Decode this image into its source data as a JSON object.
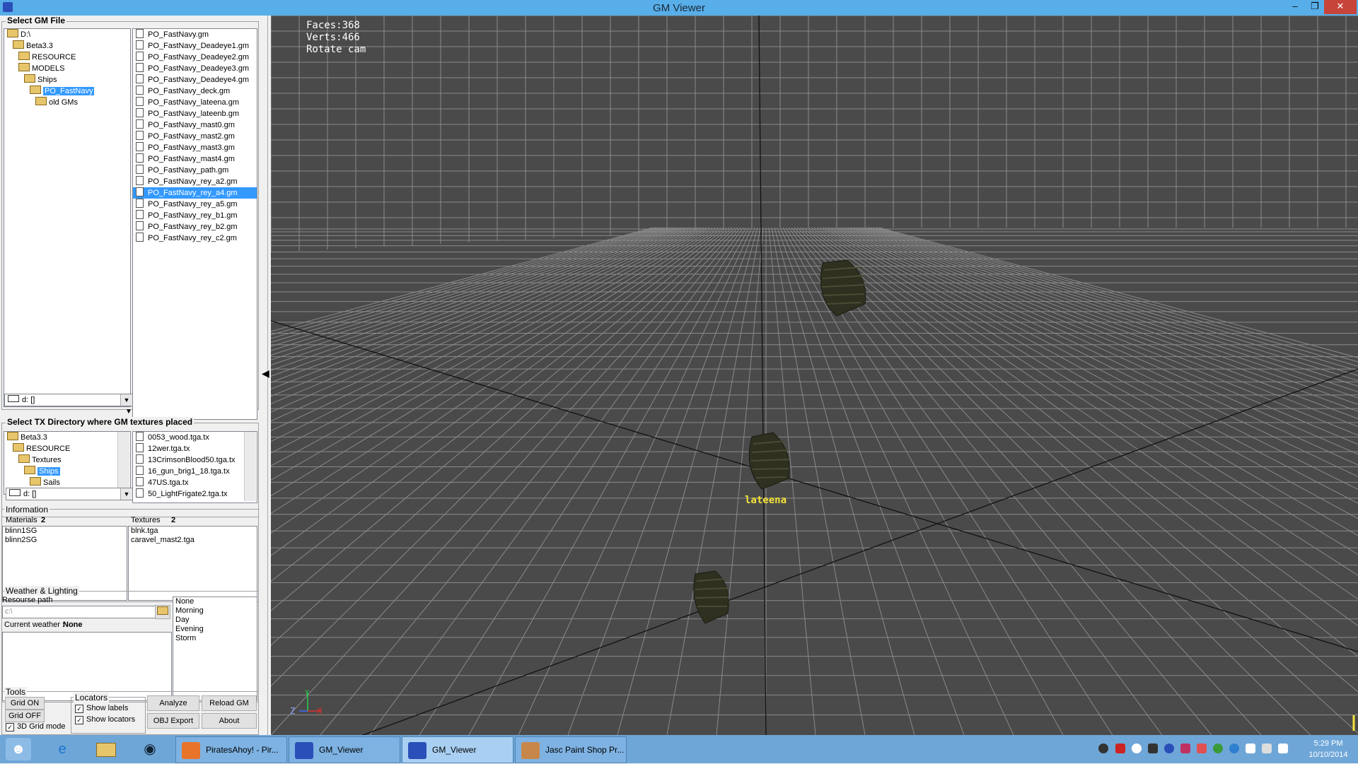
{
  "window": {
    "title": "GM Viewer",
    "minimize": "–",
    "restore": "❐",
    "close": "✕"
  },
  "gm": {
    "group_label": "Select GM File",
    "folders": [
      {
        "name": "D:\\",
        "indent": 0
      },
      {
        "name": "Beta3.3",
        "indent": 1
      },
      {
        "name": "RESOURCE",
        "indent": 2
      },
      {
        "name": "MODELS",
        "indent": 2
      },
      {
        "name": "Ships",
        "indent": 3
      },
      {
        "name": "PO_FastNavy",
        "indent": 4,
        "selected": true
      },
      {
        "name": "old GMs",
        "indent": 5
      }
    ],
    "drive": "d: []",
    "files": [
      "PO_FastNavy.gm",
      "PO_FastNavy_Deadeye1.gm",
      "PO_FastNavy_Deadeye2.gm",
      "PO_FastNavy_Deadeye3.gm",
      "PO_FastNavy_Deadeye4.gm",
      "PO_FastNavy_deck.gm",
      "PO_FastNavy_lateena.gm",
      "PO_FastNavy_lateenb.gm",
      "PO_FastNavy_mast0.gm",
      "PO_FastNavy_mast2.gm",
      "PO_FastNavy_mast3.gm",
      "PO_FastNavy_mast4.gm",
      "PO_FastNavy_path.gm",
      "PO_FastNavy_rey_a2.gm",
      "PO_FastNavy_rey_a4.gm",
      "PO_FastNavy_rey_a5.gm",
      "PO_FastNavy_rey_b1.gm",
      "PO_FastNavy_rey_b2.gm",
      "PO_FastNavy_rey_c2.gm"
    ],
    "selected_file_index": 14
  },
  "tx": {
    "group_label": "Select TX Directory where GM textures placed",
    "folders": [
      {
        "name": "Beta3.3",
        "indent": 0
      },
      {
        "name": "RESOURCE",
        "indent": 1
      },
      {
        "name": "Textures",
        "indent": 2
      },
      {
        "name": "Ships",
        "indent": 3,
        "selected": true
      },
      {
        "name": "Sails",
        "indent": 4
      }
    ],
    "drive": "d: []",
    "files": [
      "0053_wood.tga.tx",
      "12wer.tga.tx",
      "13CrimsonBlood50.tga.tx",
      "16_gun_brig1_18.tga.tx",
      "47US.tga.tx",
      "50_LightFrigate2.tga.tx"
    ]
  },
  "info": {
    "group_label": "Information",
    "materials_label": "Materials",
    "materials_count": "2",
    "textures_label": "Textures",
    "textures_count": "2",
    "materials": [
      "blinn1SG",
      "blinn2SG"
    ],
    "textures": [
      "blnk.tga",
      "caravel_mast2.tga"
    ]
  },
  "weather": {
    "group_label": "Weather & Lighting",
    "resource_path_label": "Resourse path",
    "resource_path_value": "c:\\",
    "current_label": "Current weather :",
    "current_value": "None",
    "options": [
      "None",
      "Morning",
      "Day",
      "Evening",
      "Storm"
    ]
  },
  "tools": {
    "group_label": "Tools",
    "grid_on": "Grid ON",
    "grid_off": "Grid OFF",
    "grid3d": "3D Grid mode",
    "grid3d_checked": true,
    "locators_label": "Locators",
    "show_labels": "Show labels",
    "show_labels_checked": true,
    "show_locators": "Show locators",
    "show_locators_checked": true,
    "analyze": "Analyze",
    "reload": "Reload GM",
    "obj_export": "OBJ Export",
    "about": "About"
  },
  "viewport": {
    "faces": "Faces:368",
    "verts": "Verts:466",
    "mode": "Rotate cam",
    "label": "lateena",
    "axis_x": "X",
    "axis_y": "Y",
    "axis_z": "Z",
    "collapse": "◀"
  },
  "taskbar": {
    "tasks": [
      {
        "label": "PiratesAhoy! - Pir...",
        "color": "#e8742a"
      },
      {
        "label": "GM_Viewer",
        "color": "#2b4fb8"
      },
      {
        "label": "GM_Viewer",
        "color": "#2b4fb8"
      },
      {
        "label": "Jasc Paint Shop Pr...",
        "color": "#c8874a"
      }
    ],
    "active_task_index": 2,
    "time": "5:29 PM",
    "date": "10/10/2014"
  },
  "colors": {
    "selection": "#3399ff",
    "titlebar": "#58aee8",
    "viewport_bg": "#4a4a4a",
    "label_yellow": "#f4e23a",
    "taskbar": "#6fa6d8"
  }
}
